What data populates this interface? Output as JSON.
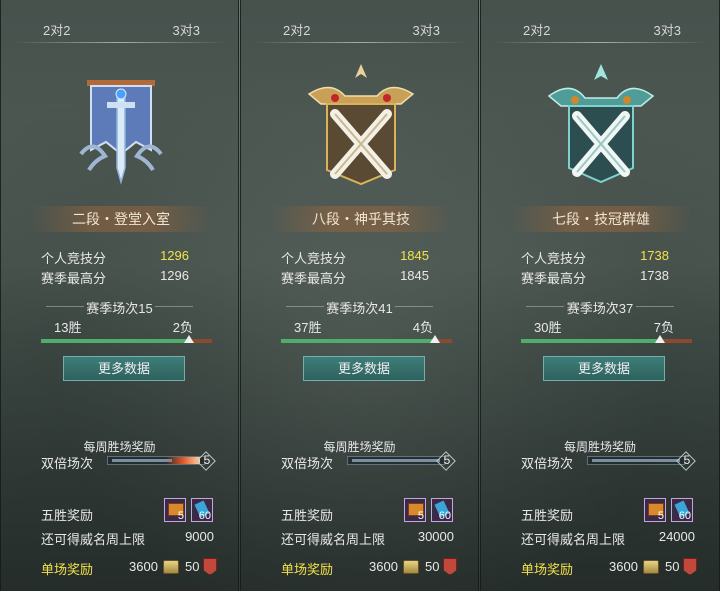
{
  "panels": [
    {
      "tabs": [
        "2对2",
        "3对3"
      ],
      "rank_title": "二段・登堂入室",
      "emblem_icon": "banner-sword-emblem-icon",
      "emblem_color": "#8fb0d8",
      "personal_score_label": "个人竞技分",
      "personal_score": "1296",
      "season_high_label": "赛季最高分",
      "season_high": "1296",
      "season_matches": "赛季场次15",
      "wins": "13胜",
      "losses": "2负",
      "win_ratio": 0.867,
      "more_button": "更多数据",
      "weekly_title": "每周胜场奖励",
      "double_label": "双倍场次",
      "double_count": "5",
      "five_win_label": "五胜奖励",
      "reward_items": [
        {
          "icon": "chest-icon",
          "count": "5"
        },
        {
          "icon": "scroll-icon",
          "count": "60"
        }
      ],
      "limit_label": "还可得威名周上限",
      "limit_value": "9000",
      "single_label": "单场奖励",
      "coin_value": "3600",
      "badge_value": "50"
    },
    {
      "tabs": [
        "2对2",
        "3对3"
      ],
      "rank_title": "八段・神乎其技",
      "emblem_icon": "golden-crossed-swords-emblem-icon",
      "emblem_color": "#d9b25a",
      "personal_score_label": "个人竞技分",
      "personal_score": "1845",
      "season_high_label": "赛季最高分",
      "season_high": "1845",
      "season_matches": "赛季场次41",
      "wins": "37胜",
      "losses": "4负",
      "win_ratio": 0.902,
      "more_button": "更多数据",
      "weekly_title": "每周胜场奖励",
      "double_label": "双倍场次",
      "double_count": "5",
      "five_win_label": "五胜奖励",
      "reward_items": [
        {
          "icon": "chest-icon",
          "count": "5"
        },
        {
          "icon": "scroll-icon",
          "count": "60"
        }
      ],
      "limit_label": "还可得威名周上限",
      "limit_value": "30000",
      "single_label": "单场奖励",
      "coin_value": "3600",
      "badge_value": "50"
    },
    {
      "tabs": [
        "2对2",
        "3对3"
      ],
      "rank_title": "七段・技冠群雄",
      "emblem_icon": "jade-crossed-swords-emblem-icon",
      "emblem_color": "#7fd2cc",
      "personal_score_label": "个人竞技分",
      "personal_score": "1738",
      "season_high_label": "赛季最高分",
      "season_high": "1738",
      "season_matches": "赛季场次37",
      "wins": "30胜",
      "losses": "7负",
      "win_ratio": 0.811,
      "more_button": "更多数据",
      "weekly_title": "每周胜场奖励",
      "double_label": "双倍场次",
      "double_count": "5",
      "five_win_label": "五胜奖励",
      "reward_items": [
        {
          "icon": "chest-icon",
          "count": "5"
        },
        {
          "icon": "scroll-icon",
          "count": "60"
        }
      ],
      "limit_label": "还可得威名周上限",
      "limit_value": "24000",
      "single_label": "单场奖励",
      "coin_value": "3600",
      "badge_value": "50"
    }
  ]
}
